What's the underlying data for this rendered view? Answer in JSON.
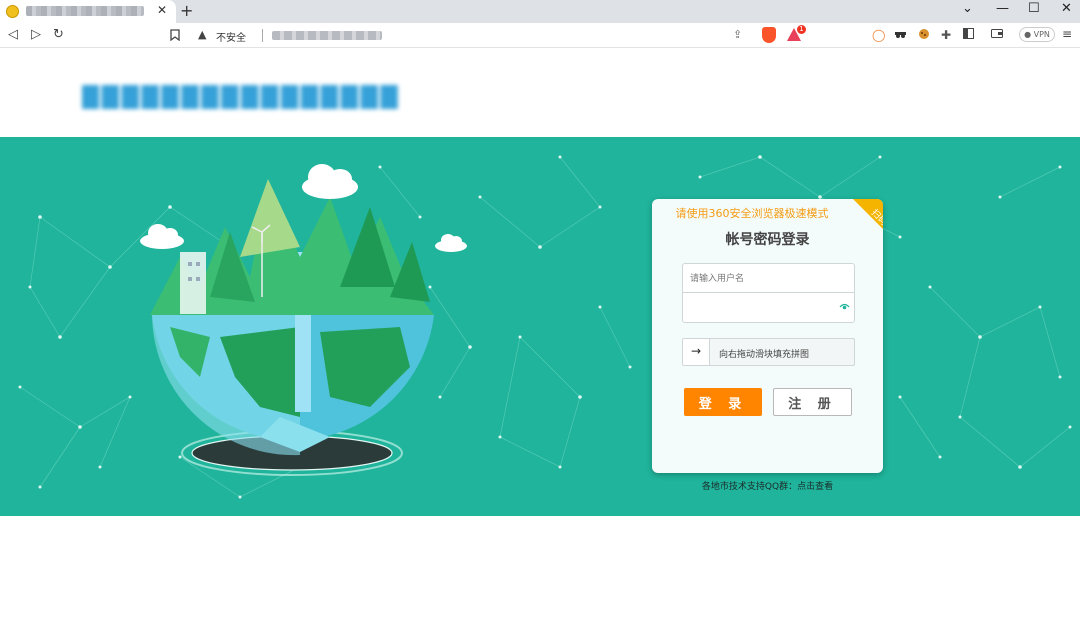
{
  "browser": {
    "tab": {
      "favicon": "site-favicon",
      "title": "████████████████",
      "close_label": "✕"
    },
    "new_tab_label": "+",
    "window_controls": {
      "tabs_menu": "⌄",
      "minimize": "—",
      "maximize": "☐",
      "close": "✕"
    },
    "nav": {
      "back": "◁",
      "forward": "▷",
      "reload": "↻",
      "bookmark": "🔖"
    },
    "address": {
      "security_label": "不安全",
      "url": "███-███-███ ████"
    },
    "extensions": [
      "share-icon",
      "brave-shields-icon",
      "brave-rewards-icon",
      "sync-icon",
      "incognito-icon",
      "cookie-icon",
      "puzzle-icon",
      "sidebar-icon",
      "wallet-icon"
    ],
    "rewards_badge": "1",
    "vpn_label": "VPN",
    "menu_label": "≡"
  },
  "header": {
    "site_title": "████████████████ ··"
  },
  "login": {
    "browser_hint": "请使用360安全浏览器极速模式",
    "corner_label": "扫码",
    "title": "帐号密码登录",
    "username_placeholder": "请输入用户名",
    "password_value": "",
    "slider_handle": "→",
    "slider_text": "向右拖动滑块填充拼图",
    "login_button": "登 录",
    "register_button": "注 册"
  },
  "support": {
    "text": "各地市技术支持QQ群：",
    "link": "点击查看"
  },
  "colors": {
    "banner": "#1fb49b",
    "accent": "#ff8400",
    "hint": "#f39c12",
    "title_blue": "#35a1d8"
  }
}
